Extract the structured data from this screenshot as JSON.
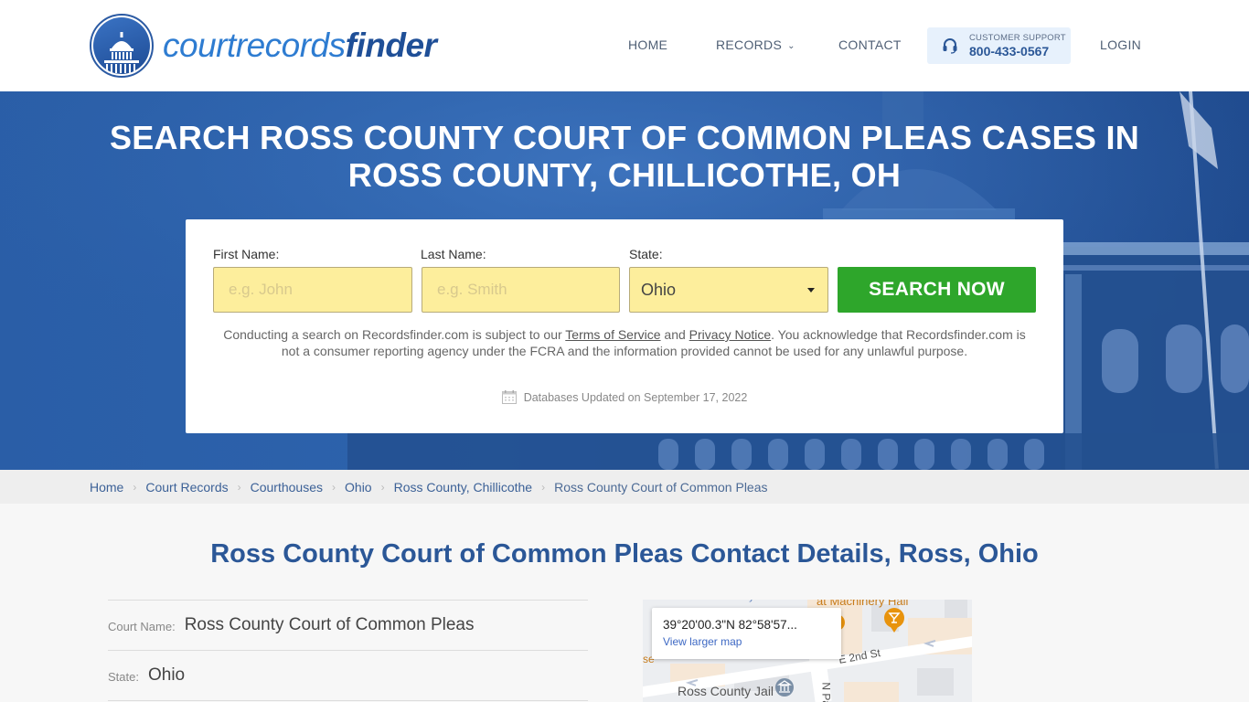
{
  "header": {
    "logo": {
      "part1": "courtrecords",
      "part2": "finder"
    },
    "nav": {
      "home": "HOME",
      "records": "RECORDS",
      "contact": "CONTACT",
      "login": "LOGIN"
    },
    "support": {
      "label": "CUSTOMER SUPPORT",
      "phone": "800-433-0567"
    }
  },
  "hero": {
    "title_line1": "SEARCH ROSS COUNTY COURT OF COMMON PLEAS CASES IN",
    "title_line2": "ROSS COUNTY, CHILLICOTHE, OH"
  },
  "search": {
    "first_name_label": "First Name:",
    "first_name_placeholder": "e.g. John",
    "first_name_value": "",
    "last_name_label": "Last Name:",
    "last_name_placeholder": "e.g. Smith",
    "last_name_value": "",
    "state_label": "State:",
    "state_value": "Ohio",
    "button_label": "SEARCH NOW",
    "disclaimer_pre": "Conducting a search on Recordsfinder.com is subject to our ",
    "terms_link": "Terms of Service",
    "disclaimer_and": " and ",
    "privacy_link": "Privacy Notice",
    "disclaimer_post": ". You acknowledge that Recordsfinder.com is not a consumer reporting agency under the FCRA and the information provided cannot be used for any unlawful purpose.",
    "db_updated": "Databases Updated on September 17, 2022"
  },
  "breadcrumb": [
    {
      "label": "Home"
    },
    {
      "label": "Court Records"
    },
    {
      "label": "Courthouses"
    },
    {
      "label": "Ohio"
    },
    {
      "label": "Ross County, Chillicothe"
    },
    {
      "label": "Ross County Court of Common Pleas"
    }
  ],
  "content": {
    "title": "Ross County Court of Common Pleas Contact Details, Ross, Ohio",
    "details": [
      {
        "label": "Court Name:",
        "value": "Ross County Court of Common Pleas"
      },
      {
        "label": "State:",
        "value": "Ohio"
      }
    ]
  },
  "map": {
    "coords": "39°20'00.3\"N 82°58'57...",
    "link": "View larger map",
    "labels": {
      "candy": "Candy Store",
      "machinery": "at Machinery Hall",
      "street": "E 2nd St",
      "jail": "Ross County Jail",
      "npaint": "N Pai",
      "se": "se"
    }
  },
  "colors": {
    "brand_blue": "#2b5797",
    "search_green": "#2ea62b",
    "input_yellow": "#fdee9c",
    "hero_blue": "#2a5ea7"
  }
}
